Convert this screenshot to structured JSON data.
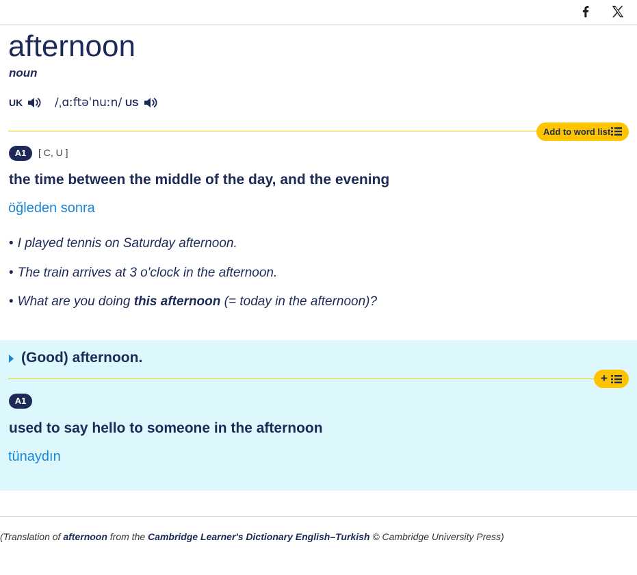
{
  "share": {
    "facebook_icon": "facebook-icon",
    "x_icon": "x-icon"
  },
  "entry": {
    "headword": "afternoon",
    "pos": "noun",
    "pronunciation": {
      "uk_label": "UK",
      "us_label": "US",
      "ipa": "/ˌɑːftəˈnuːn/"
    },
    "add_to_word_list": "Add to word list"
  },
  "sense1": {
    "level": "A1",
    "grammar": "[ C, U ]",
    "definition": "the time between the middle of the day, and the evening",
    "translation": "öğleden sonra",
    "examples": [
      {
        "bullet": "•",
        "text": "I played tennis on Saturday afternoon."
      },
      {
        "bullet": "•",
        "text": "The train arrives at 3 o'clock in the afternoon."
      },
      {
        "bullet": "•",
        "pre": "What are you doing ",
        "bold": "this afternoon",
        "post": " (= today in the afternoon)?"
      }
    ]
  },
  "phrase": {
    "title": "(Good) afternoon.",
    "plus": "+",
    "level": "A1",
    "definition": "used to say hello to someone in the afternoon",
    "translation": "tünaydın"
  },
  "credit": {
    "p1": "(Translation of ",
    "word": "afternoon",
    "p2": " from the ",
    "dictionary": "Cambridge Learner's Dictionary English–Turkish",
    "p3": " © Cambridge University Press)"
  },
  "colors": {
    "navy": "#1d2a57",
    "translation_blue": "#1a85d5",
    "accent_yellow": "#fec400",
    "phrase_bg": "#dcf8fc"
  }
}
